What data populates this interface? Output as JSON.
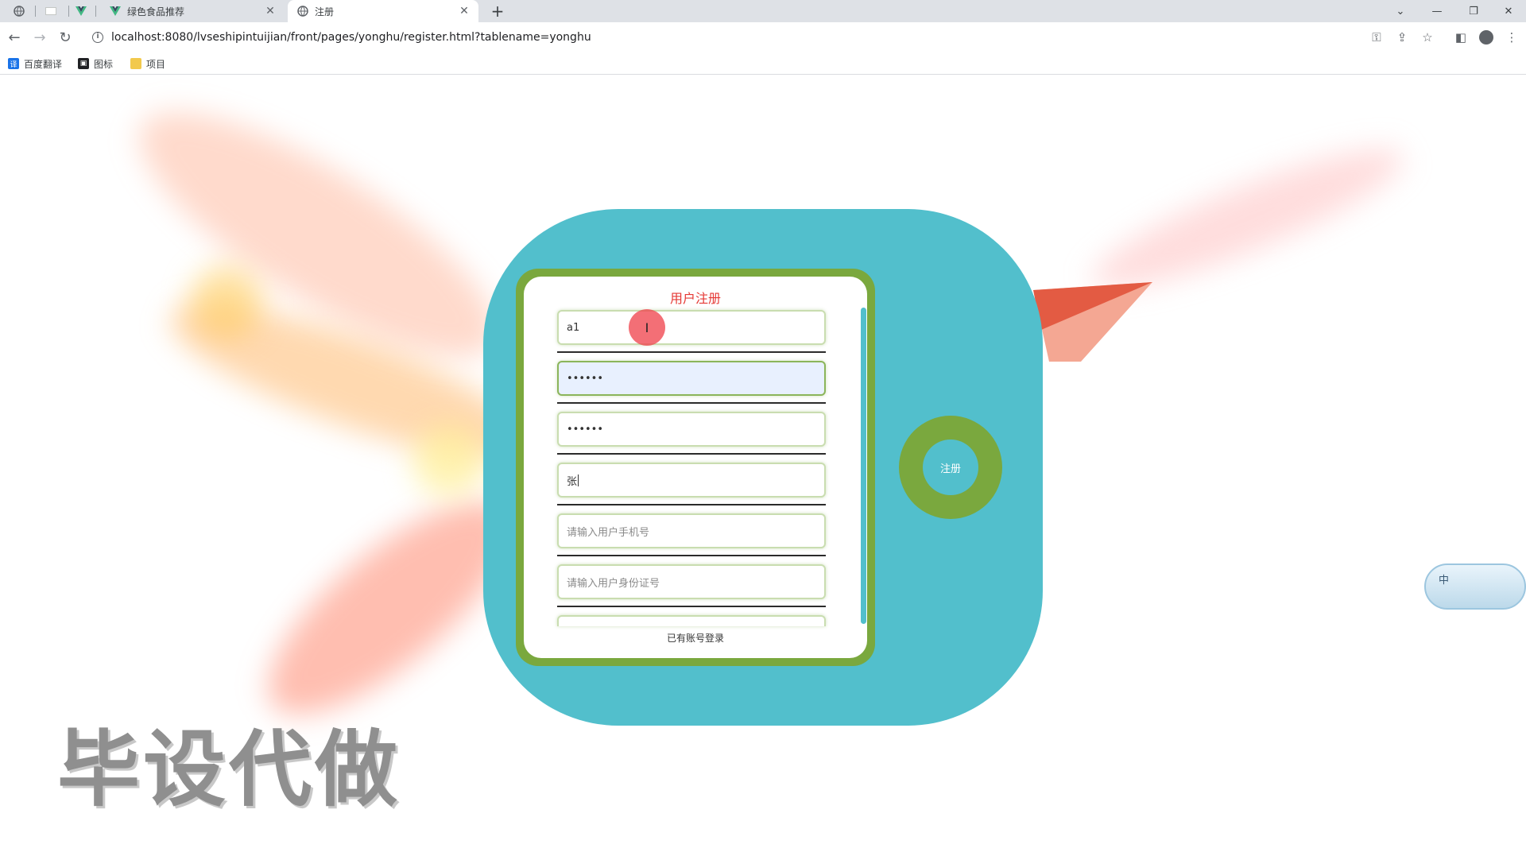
{
  "browser": {
    "tabs": [
      {
        "title": "绿色食品推荐",
        "active": false
      },
      {
        "title": "注册",
        "active": true
      }
    ],
    "address": "localhost:8080/lvseshipintuijian/front/pages/yonghu/register.html?tablename=yonghu",
    "bookmarks": [
      {
        "label": "百度翻译",
        "icon": "translate-icon",
        "color": "#1a73e8"
      },
      {
        "label": "图标",
        "icon": "image-icon",
        "color": "#202124"
      },
      {
        "label": "项目",
        "icon": "folder-icon",
        "color": "#f2c94c"
      }
    ]
  },
  "form": {
    "title": "用户注册",
    "fields": [
      {
        "value": "a1",
        "placeholder": ""
      },
      {
        "value": "••••••",
        "placeholder": ""
      },
      {
        "value": "••••••",
        "placeholder": ""
      },
      {
        "value": "张",
        "placeholder": ""
      },
      {
        "value": "",
        "placeholder": "请输入用户手机号"
      },
      {
        "value": "",
        "placeholder": "请输入用户身份证号"
      }
    ],
    "login_link": "已有账号登录",
    "register_button": "注册"
  },
  "ime": {
    "label": "中"
  },
  "watermark": "毕设代做",
  "colors": {
    "teal": "#52bfcc",
    "green": "#7aa83e",
    "title_red": "#e53935"
  }
}
